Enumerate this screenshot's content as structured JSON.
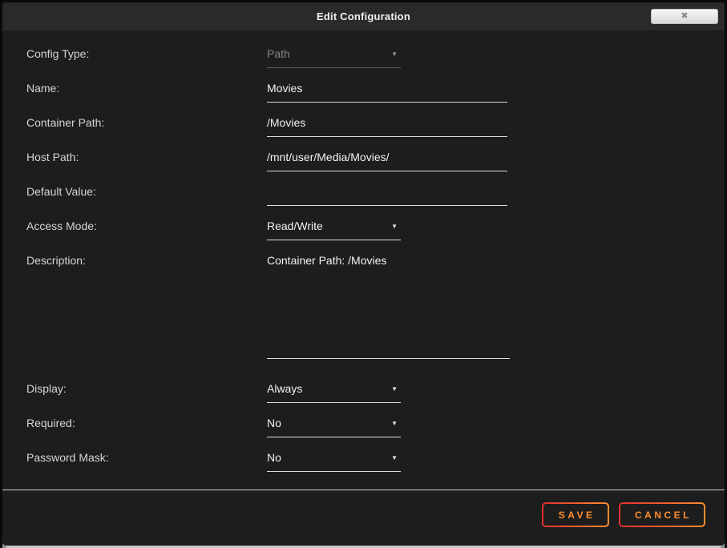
{
  "dialog": {
    "title": "Edit Configuration"
  },
  "icons": {
    "close": "✖",
    "dropdown_arrow": "▼"
  },
  "form": {
    "config_type": {
      "label": "Config Type:",
      "value": "Path",
      "control": "select",
      "disabled": true
    },
    "name": {
      "label": "Name:",
      "value": "Movies",
      "control": "input"
    },
    "container_path": {
      "label": "Container Path:",
      "value": "/Movies",
      "control": "input"
    },
    "host_path": {
      "label": "Host Path:",
      "value": "/mnt/user/Media/Movies/",
      "control": "input"
    },
    "default_value": {
      "label": "Default Value:",
      "value": "",
      "control": "input"
    },
    "access_mode": {
      "label": "Access Mode:",
      "value": "Read/Write",
      "control": "select"
    },
    "description": {
      "label": "Description:",
      "value": "Container Path: /Movies",
      "control": "textarea"
    },
    "display": {
      "label": "Display:",
      "value": "Always",
      "control": "select"
    },
    "required": {
      "label": "Required:",
      "value": "No",
      "control": "select"
    },
    "password_mask": {
      "label": "Password Mask:",
      "value": "No",
      "control": "select"
    }
  },
  "footer": {
    "save_label": "SAVE",
    "cancel_label": "CANCEL"
  },
  "colors": {
    "accent_orange": "#ff8c2e",
    "accent_red": "#e22f2f",
    "titlebar_bg": "#2a2a2a",
    "body_bg": "#1d1d1d"
  }
}
